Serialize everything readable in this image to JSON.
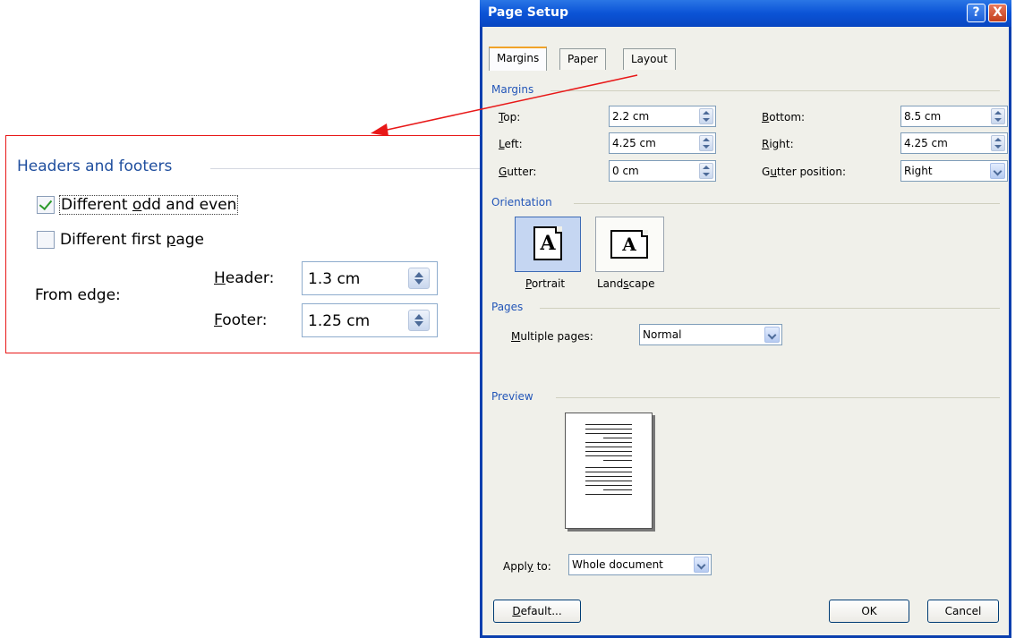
{
  "callout": {
    "title": "Headers and footers",
    "odd_even_pre": "Different ",
    "odd_even_u": "o",
    "odd_even_post": "dd and even",
    "first_page_pre": "Different first ",
    "first_page_u": "p",
    "first_page_post": "age",
    "from_edge": "From edge:",
    "header_u": "H",
    "header_rest": "eader:",
    "header_value": "1.3 cm",
    "footer_u": "F",
    "footer_rest": "ooter:",
    "footer_value": "1.25 cm"
  },
  "dialog": {
    "title": "Page Setup",
    "help": "?",
    "close": "X",
    "tabs": [
      "Margins",
      "Paper",
      "Layout"
    ],
    "margins": {
      "group": "Margins",
      "top_u": "T",
      "top_rest": "op:",
      "top_value": "2.2 cm",
      "left_u": "L",
      "left_rest": "eft:",
      "left_value": "4.25 cm",
      "gutter_u": "G",
      "gutter_rest": "utter:",
      "gutter_value": "0 cm",
      "bottom_u": "B",
      "bottom_rest": "ottom:",
      "bottom_value": "8.5 cm",
      "right_u": "R",
      "right_rest": "ight:",
      "right_value": "4.25 cm",
      "gpos_pre": "G",
      "gpos_u": "u",
      "gpos_post": "tter position:",
      "gpos_value": "Right"
    },
    "orientation": {
      "group": "Orientation",
      "portrait_pre": "",
      "portrait_u": "P",
      "portrait_post": "ortrait",
      "landscape_pre": "Land",
      "landscape_u": "s",
      "landscape_post": "cape",
      "glyph": "A"
    },
    "pages": {
      "group": "Pages",
      "multiple_u": "M",
      "multiple_rest": "ultiple pages:",
      "multiple_value": "Normal"
    },
    "preview": {
      "group": "Preview",
      "apply_pre": "Appl",
      "apply_u": "y",
      "apply_post": " to:",
      "apply_value": "Whole document"
    },
    "buttons": {
      "default_u": "D",
      "default_rest": "efault...",
      "ok": "OK",
      "cancel": "Cancel"
    }
  },
  "colors": {
    "accent_arrow": "#e81818",
    "titlebar": "#0b53d6",
    "group_title": "#2356b8"
  }
}
